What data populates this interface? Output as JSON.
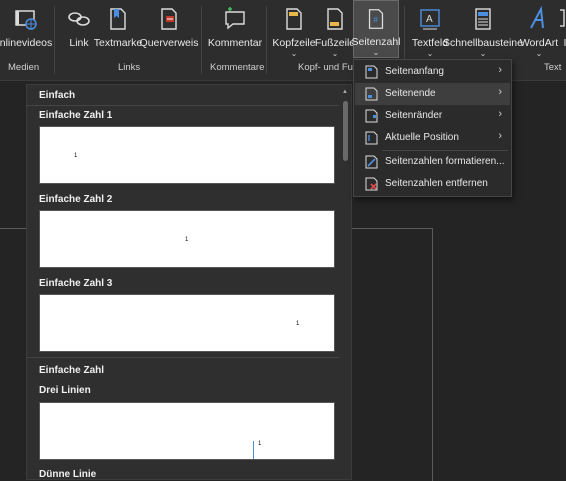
{
  "ribbon": {
    "buttons": [
      {
        "label": "nlinevideos",
        "icon": "online-video-icon"
      },
      {
        "label": "Link",
        "icon": "link-icon"
      },
      {
        "label": "Textmarke",
        "icon": "bookmark-icon"
      },
      {
        "label": "Querverweis",
        "icon": "cross-reference-icon"
      },
      {
        "label": "Kommentar",
        "icon": "comment-icon"
      },
      {
        "label": "Kopfzeile",
        "icon": "header-icon"
      },
      {
        "label": "Fußzeile",
        "icon": "footer-icon"
      },
      {
        "label": "Seitenzahl",
        "icon": "page-number-icon"
      },
      {
        "label": "Textfeld",
        "icon": "textbox-icon"
      },
      {
        "label": "Schnellbausteine",
        "icon": "quick-parts-icon"
      },
      {
        "label": "WordArt",
        "icon": "wordart-icon"
      },
      {
        "label": "I",
        "icon": "initial-icon"
      }
    ],
    "groups": [
      "Medien",
      "Links",
      "Kommentare",
      "Kopf- und Fuß",
      "Text"
    ]
  },
  "gallery": {
    "section1": "Einfach",
    "items": [
      {
        "title": "Einfache Zahl 1",
        "number": "1"
      },
      {
        "title": "Einfache Zahl 2",
        "number": "1"
      },
      {
        "title": "Einfache Zahl 3",
        "number": "1"
      }
    ],
    "section2": "Einfache Zahl",
    "item4": {
      "title": "Drei Linien",
      "number": "1"
    },
    "item5_title": "Dünne Linie"
  },
  "menu": {
    "items": [
      {
        "label": "Seitenanfang",
        "icon": "page-top-icon",
        "submenu": true
      },
      {
        "label": "Seitenende",
        "icon": "page-bottom-icon",
        "submenu": true,
        "highlighted": true
      },
      {
        "label": "Seitenränder",
        "icon": "page-margins-icon",
        "submenu": true
      },
      {
        "label": "Aktuelle Position",
        "icon": "current-position-icon",
        "submenu": true
      },
      {
        "label": "Seitenzahlen formatieren...",
        "icon": "format-page-numbers-icon",
        "submenu": false
      },
      {
        "label": "Seitenzahlen entfernen",
        "icon": "remove-page-numbers-icon",
        "submenu": false
      }
    ],
    "arrow": "›"
  },
  "colors": {
    "accent": "#4a8fe0",
    "menu_highlight": "#3e3e3e",
    "ribbon_bg": "#2d2d2d"
  }
}
